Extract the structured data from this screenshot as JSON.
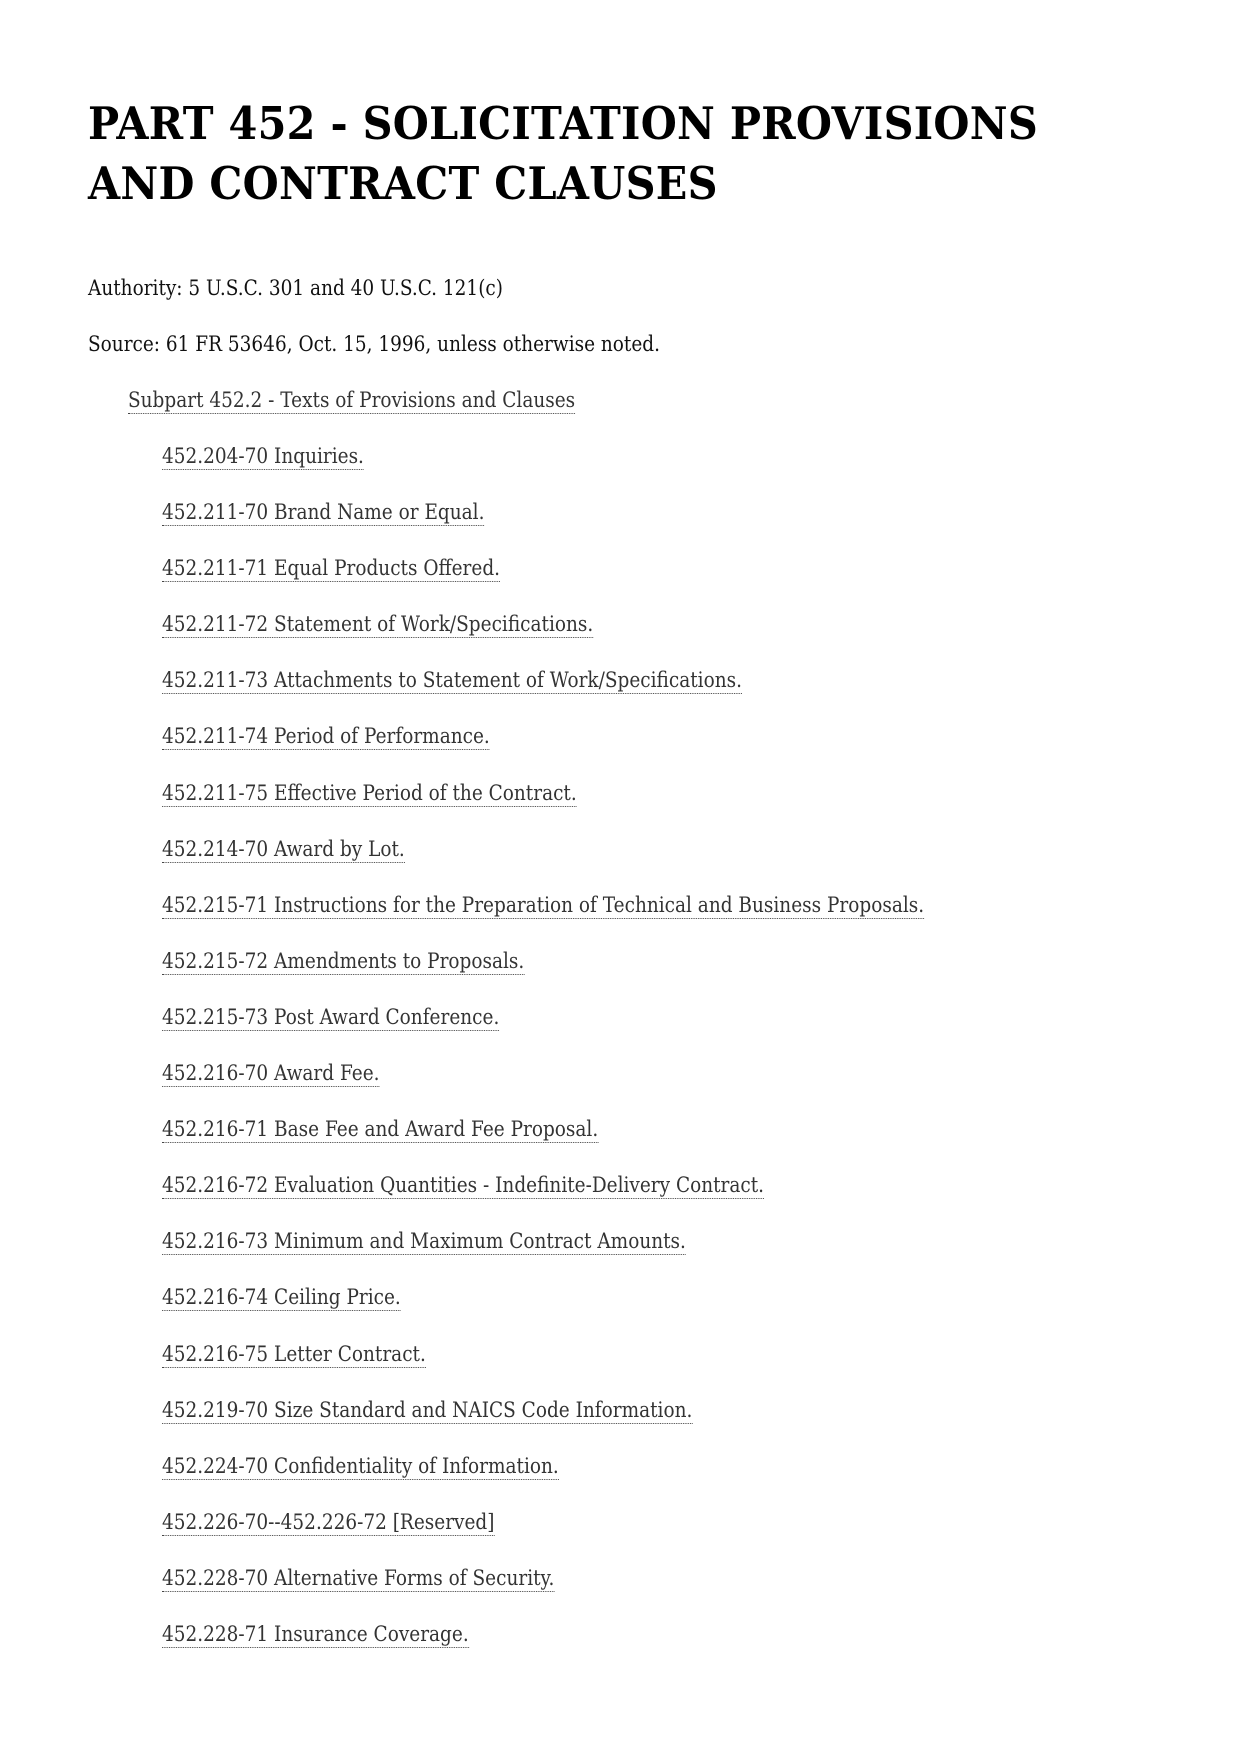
{
  "document": {
    "title": "PART 452 - SOLICITATION PROVISIONS AND CONTRACT CLAUSES",
    "authority": "Authority: 5 U.S.C. 301 and 40 U.S.C. 121(c)",
    "source": "Source: 61 FR 53646, Oct. 15, 1996, unless otherwise noted.",
    "subpart": {
      "label": "Subpart 452.2 - Texts of Provisions and Clauses",
      "sections": [
        {
          "label": "452.204-70 Inquiries."
        },
        {
          "label": "452.211-70 Brand Name or Equal."
        },
        {
          "label": "452.211-71 Equal Products Offered."
        },
        {
          "label": "452.211-72 Statement of Work/Specifications."
        },
        {
          "label": "452.211-73 Attachments to Statement of Work/Specifications."
        },
        {
          "label": "452.211-74 Period of Performance."
        },
        {
          "label": "452.211-75 Effective Period of the Contract."
        },
        {
          "label": "452.214-70 Award by Lot."
        },
        {
          "label": "452.215-71 Instructions for the Preparation of Technical and Business Proposals."
        },
        {
          "label": "452.215-72 Amendments to Proposals."
        },
        {
          "label": "452.215-73 Post Award Conference."
        },
        {
          "label": "452.216-70 Award Fee."
        },
        {
          "label": "452.216-71 Base Fee and Award Fee Proposal."
        },
        {
          "label": "452.216-72 Evaluation Quantities - Indefinite-Delivery Contract."
        },
        {
          "label": "452.216-73 Minimum and Maximum Contract Amounts."
        },
        {
          "label": "452.216-74 Ceiling Price."
        },
        {
          "label": "452.216-75 Letter Contract."
        },
        {
          "label": "452.219-70 Size Standard and NAICS Code Information."
        },
        {
          "label": "452.224-70 Confidentiality of Information."
        },
        {
          "label": "452.226-70--452.226-72 [Reserved]"
        },
        {
          "label": "452.228-70 Alternative Forms of Security."
        },
        {
          "label": "452.228-71 Insurance Coverage."
        }
      ]
    }
  }
}
